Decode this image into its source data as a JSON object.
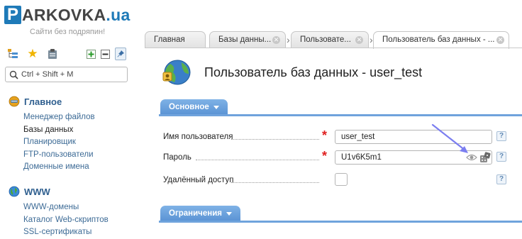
{
  "brand": {
    "logo_letter": "P",
    "logo_rest": "ARKOVKA",
    "logo_dot": ".",
    "logo_tld": "ua",
    "slogan": "Сайти без подряпин!"
  },
  "sidebar": {
    "search_placeholder": "Ctrl + Shift + M",
    "groups": [
      {
        "title": "Главное",
        "items": [
          "Менеджер файлов",
          "Базы данных",
          "Планировщик",
          "FTP-пользователи",
          "Доменные имена"
        ]
      },
      {
        "title": "WWW",
        "items": [
          "WWW-домены",
          "Каталог Web-скриптов",
          "SSL-сертификаты"
        ]
      }
    ],
    "active_item": "Базы данных"
  },
  "tabs": [
    {
      "label": "Главная",
      "closable": false
    },
    {
      "label": "Базы данны...",
      "closable": true
    },
    {
      "label": "Пользовате...",
      "closable": true
    },
    {
      "label": "Пользователь баз данных - ...",
      "closable": true,
      "active": true
    }
  ],
  "page": {
    "title": "Пользователь баз данных - user_test"
  },
  "sections": {
    "main_label": "Основное",
    "limits_label": "Ограничения"
  },
  "form": {
    "username_label": "Имя пользователя",
    "username_value": "user_test",
    "password_label": "Пароль",
    "password_value": "U1v6K5m1",
    "remote_label": "Удалённый доступ",
    "remote_checked": false,
    "required_mark": "*",
    "help_mark": "?"
  },
  "colors": {
    "brand_blue": "#1e7ab8",
    "section_blue": "#6fa3dc",
    "link_blue": "#3d6b96",
    "required_red": "#e02020",
    "annotation_arrow": "#7b7ef0"
  }
}
